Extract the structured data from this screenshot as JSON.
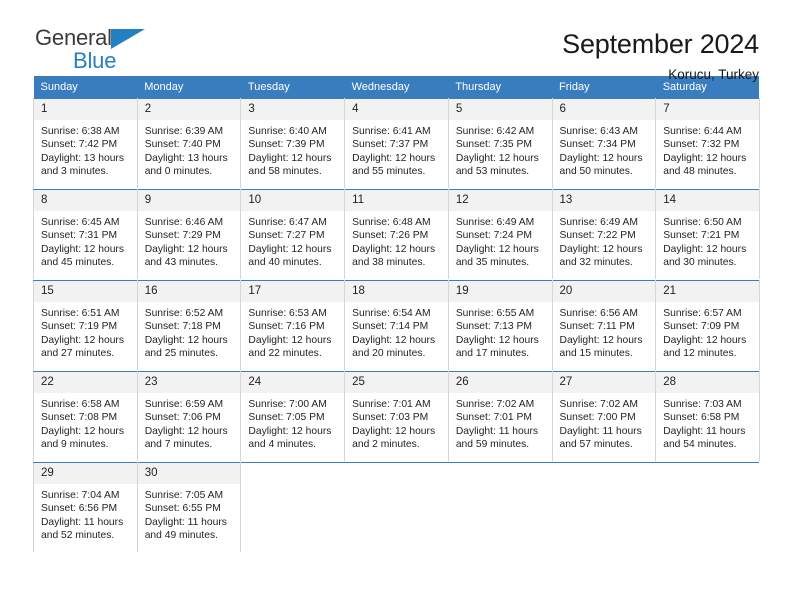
{
  "brand": {
    "line1": "General",
    "line2": "Blue",
    "triangle_color": "#2580c3",
    "text_color": "#3b3b3b"
  },
  "header": {
    "title": "September 2024",
    "location": "Korucu, Turkey"
  },
  "theme": {
    "header_bg": "#3a7dbf",
    "daynum_bg": "#f2f2f2",
    "grid_border": "#d5d5d5",
    "row_top_border": "#3a7dbf"
  },
  "weekdays": [
    "Sunday",
    "Monday",
    "Tuesday",
    "Wednesday",
    "Thursday",
    "Friday",
    "Saturday"
  ],
  "weeks": [
    [
      {
        "day": "1",
        "sunrise": "Sunrise: 6:38 AM",
        "sunset": "Sunset: 7:42 PM",
        "daylight1": "Daylight: 13 hours",
        "daylight2": "and 3 minutes."
      },
      {
        "day": "2",
        "sunrise": "Sunrise: 6:39 AM",
        "sunset": "Sunset: 7:40 PM",
        "daylight1": "Daylight: 13 hours",
        "daylight2": "and 0 minutes."
      },
      {
        "day": "3",
        "sunrise": "Sunrise: 6:40 AM",
        "sunset": "Sunset: 7:39 PM",
        "daylight1": "Daylight: 12 hours",
        "daylight2": "and 58 minutes."
      },
      {
        "day": "4",
        "sunrise": "Sunrise: 6:41 AM",
        "sunset": "Sunset: 7:37 PM",
        "daylight1": "Daylight: 12 hours",
        "daylight2": "and 55 minutes."
      },
      {
        "day": "5",
        "sunrise": "Sunrise: 6:42 AM",
        "sunset": "Sunset: 7:35 PM",
        "daylight1": "Daylight: 12 hours",
        "daylight2": "and 53 minutes."
      },
      {
        "day": "6",
        "sunrise": "Sunrise: 6:43 AM",
        "sunset": "Sunset: 7:34 PM",
        "daylight1": "Daylight: 12 hours",
        "daylight2": "and 50 minutes."
      },
      {
        "day": "7",
        "sunrise": "Sunrise: 6:44 AM",
        "sunset": "Sunset: 7:32 PM",
        "daylight1": "Daylight: 12 hours",
        "daylight2": "and 48 minutes."
      }
    ],
    [
      {
        "day": "8",
        "sunrise": "Sunrise: 6:45 AM",
        "sunset": "Sunset: 7:31 PM",
        "daylight1": "Daylight: 12 hours",
        "daylight2": "and 45 minutes."
      },
      {
        "day": "9",
        "sunrise": "Sunrise: 6:46 AM",
        "sunset": "Sunset: 7:29 PM",
        "daylight1": "Daylight: 12 hours",
        "daylight2": "and 43 minutes."
      },
      {
        "day": "10",
        "sunrise": "Sunrise: 6:47 AM",
        "sunset": "Sunset: 7:27 PM",
        "daylight1": "Daylight: 12 hours",
        "daylight2": "and 40 minutes."
      },
      {
        "day": "11",
        "sunrise": "Sunrise: 6:48 AM",
        "sunset": "Sunset: 7:26 PM",
        "daylight1": "Daylight: 12 hours",
        "daylight2": "and 38 minutes."
      },
      {
        "day": "12",
        "sunrise": "Sunrise: 6:49 AM",
        "sunset": "Sunset: 7:24 PM",
        "daylight1": "Daylight: 12 hours",
        "daylight2": "and 35 minutes."
      },
      {
        "day": "13",
        "sunrise": "Sunrise: 6:49 AM",
        "sunset": "Sunset: 7:22 PM",
        "daylight1": "Daylight: 12 hours",
        "daylight2": "and 32 minutes."
      },
      {
        "day": "14",
        "sunrise": "Sunrise: 6:50 AM",
        "sunset": "Sunset: 7:21 PM",
        "daylight1": "Daylight: 12 hours",
        "daylight2": "and 30 minutes."
      }
    ],
    [
      {
        "day": "15",
        "sunrise": "Sunrise: 6:51 AM",
        "sunset": "Sunset: 7:19 PM",
        "daylight1": "Daylight: 12 hours",
        "daylight2": "and 27 minutes."
      },
      {
        "day": "16",
        "sunrise": "Sunrise: 6:52 AM",
        "sunset": "Sunset: 7:18 PM",
        "daylight1": "Daylight: 12 hours",
        "daylight2": "and 25 minutes."
      },
      {
        "day": "17",
        "sunrise": "Sunrise: 6:53 AM",
        "sunset": "Sunset: 7:16 PM",
        "daylight1": "Daylight: 12 hours",
        "daylight2": "and 22 minutes."
      },
      {
        "day": "18",
        "sunrise": "Sunrise: 6:54 AM",
        "sunset": "Sunset: 7:14 PM",
        "daylight1": "Daylight: 12 hours",
        "daylight2": "and 20 minutes."
      },
      {
        "day": "19",
        "sunrise": "Sunrise: 6:55 AM",
        "sunset": "Sunset: 7:13 PM",
        "daylight1": "Daylight: 12 hours",
        "daylight2": "and 17 minutes."
      },
      {
        "day": "20",
        "sunrise": "Sunrise: 6:56 AM",
        "sunset": "Sunset: 7:11 PM",
        "daylight1": "Daylight: 12 hours",
        "daylight2": "and 15 minutes."
      },
      {
        "day": "21",
        "sunrise": "Sunrise: 6:57 AM",
        "sunset": "Sunset: 7:09 PM",
        "daylight1": "Daylight: 12 hours",
        "daylight2": "and 12 minutes."
      }
    ],
    [
      {
        "day": "22",
        "sunrise": "Sunrise: 6:58 AM",
        "sunset": "Sunset: 7:08 PM",
        "daylight1": "Daylight: 12 hours",
        "daylight2": "and 9 minutes."
      },
      {
        "day": "23",
        "sunrise": "Sunrise: 6:59 AM",
        "sunset": "Sunset: 7:06 PM",
        "daylight1": "Daylight: 12 hours",
        "daylight2": "and 7 minutes."
      },
      {
        "day": "24",
        "sunrise": "Sunrise: 7:00 AM",
        "sunset": "Sunset: 7:05 PM",
        "daylight1": "Daylight: 12 hours",
        "daylight2": "and 4 minutes."
      },
      {
        "day": "25",
        "sunrise": "Sunrise: 7:01 AM",
        "sunset": "Sunset: 7:03 PM",
        "daylight1": "Daylight: 12 hours",
        "daylight2": "and 2 minutes."
      },
      {
        "day": "26",
        "sunrise": "Sunrise: 7:02 AM",
        "sunset": "Sunset: 7:01 PM",
        "daylight1": "Daylight: 11 hours",
        "daylight2": "and 59 minutes."
      },
      {
        "day": "27",
        "sunrise": "Sunrise: 7:02 AM",
        "sunset": "Sunset: 7:00 PM",
        "daylight1": "Daylight: 11 hours",
        "daylight2": "and 57 minutes."
      },
      {
        "day": "28",
        "sunrise": "Sunrise: 7:03 AM",
        "sunset": "Sunset: 6:58 PM",
        "daylight1": "Daylight: 11 hours",
        "daylight2": "and 54 minutes."
      }
    ],
    [
      {
        "day": "29",
        "sunrise": "Sunrise: 7:04 AM",
        "sunset": "Sunset: 6:56 PM",
        "daylight1": "Daylight: 11 hours",
        "daylight2": "and 52 minutes."
      },
      {
        "day": "30",
        "sunrise": "Sunrise: 7:05 AM",
        "sunset": "Sunset: 6:55 PM",
        "daylight1": "Daylight: 11 hours",
        "daylight2": "and 49 minutes."
      },
      null,
      null,
      null,
      null,
      null
    ]
  ]
}
